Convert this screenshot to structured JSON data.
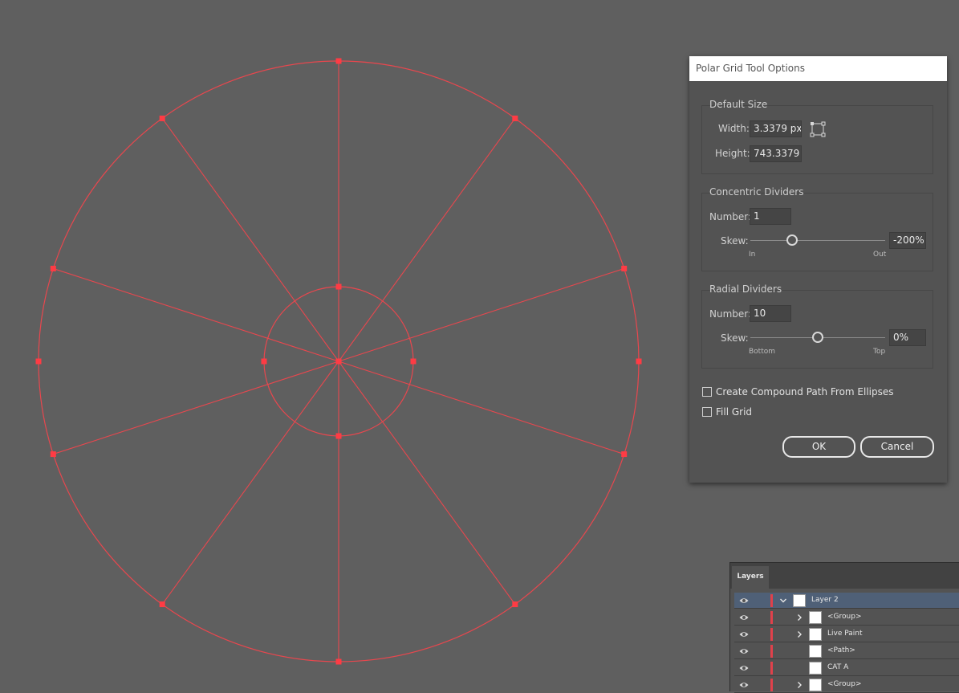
{
  "canvas": {
    "grid_color": "#e8474e",
    "anchor_color": "#ff3b44",
    "radial_dividers": 10,
    "concentric_dividers": 1
  },
  "dialog": {
    "title": "Polar Grid Tool Options",
    "default_size": {
      "title": "Default Size",
      "width_label": "Width:",
      "width_value": "3.3379 px",
      "height_label": "Height:",
      "height_value": "743.3379"
    },
    "concentric": {
      "title": "Concentric Dividers",
      "number_label": "Number:",
      "number_value": "1",
      "skew_label": "Skew:",
      "skew_value": "-200%",
      "skew_level": 0.31,
      "min_label": "In",
      "max_label": "Out"
    },
    "radial": {
      "title": "Radial Dividers",
      "number_label": "Number:",
      "number_value": "10",
      "skew_label": "Skew:",
      "skew_value": "0%",
      "skew_level": 0.5,
      "min_label": "Bottom",
      "max_label": "Top"
    },
    "compound_path_label": "Create Compound Path From Ellipses",
    "compound_path_checked": false,
    "fill_grid_label": "Fill Grid",
    "fill_grid_checked": false,
    "ok_label": "OK",
    "cancel_label": "Cancel"
  },
  "layers_panel": {
    "tab_label": "Layers",
    "rows": [
      {
        "name": "Layer 2",
        "expander": "expanded",
        "selected": true
      },
      {
        "name": "<Group>",
        "expander": "collapsed",
        "selected": false
      },
      {
        "name": "Live Paint",
        "expander": "collapsed",
        "selected": false
      },
      {
        "name": "<Path>",
        "expander": "none",
        "selected": false
      },
      {
        "name": "CAT A",
        "expander": "none",
        "selected": false
      },
      {
        "name": "<Group>",
        "expander": "collapsed",
        "selected": false
      }
    ]
  }
}
